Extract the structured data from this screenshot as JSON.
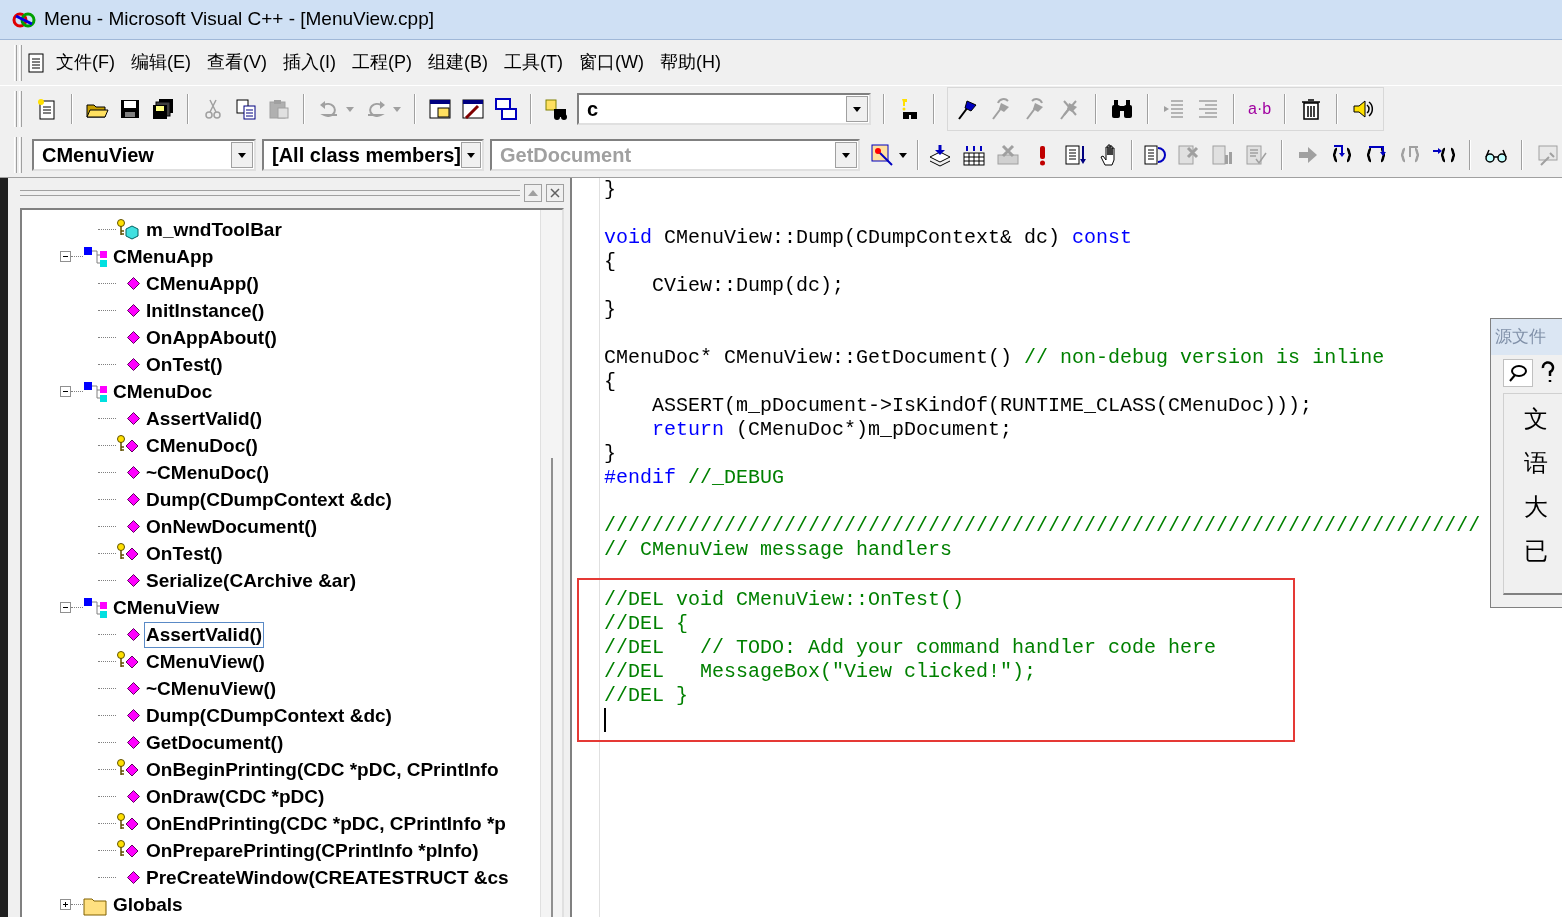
{
  "window": {
    "title": "Menu - Microsoft Visual C++ - [MenuView.cpp]"
  },
  "menu": [
    {
      "label": "文件(F)"
    },
    {
      "label": "编辑(E)"
    },
    {
      "label": "查看(V)"
    },
    {
      "label": "插入(I)"
    },
    {
      "label": "工程(P)"
    },
    {
      "label": "组建(B)"
    },
    {
      "label": "工具(T)"
    },
    {
      "label": "窗口(W)"
    },
    {
      "label": "帮助(H)"
    }
  ],
  "toolbar": {
    "find_combo": {
      "value": "c"
    },
    "format_label": "a·b"
  },
  "wizard_bar": {
    "class_combo": {
      "value": "CMenuView"
    },
    "filter_combo": {
      "value": "[All class members]"
    },
    "member_combo": {
      "value": "GetDocument",
      "disabled": true
    }
  },
  "class_view": {
    "continued_children": [
      {
        "label": "m_wndToolBar",
        "kind": "protected_member",
        "selected": false
      }
    ],
    "items": [
      {
        "label": "CMenuApp",
        "kind": "class",
        "expanded": true,
        "selected": false,
        "children": [
          {
            "label": "CMenuApp()",
            "kind": "method",
            "selected": false
          },
          {
            "label": "InitInstance()",
            "kind": "method",
            "selected": false
          },
          {
            "label": "OnAppAbout()",
            "kind": "method",
            "selected": false
          },
          {
            "label": "OnTest()",
            "kind": "method",
            "selected": false
          }
        ]
      },
      {
        "label": "CMenuDoc",
        "kind": "class",
        "expanded": true,
        "selected": false,
        "children": [
          {
            "label": "AssertValid()",
            "kind": "method",
            "selected": false
          },
          {
            "label": "CMenuDoc()",
            "kind": "protected_method",
            "selected": false
          },
          {
            "label": "~CMenuDoc()",
            "kind": "method",
            "selected": false
          },
          {
            "label": "Dump(CDumpContext &dc)",
            "kind": "method",
            "selected": false
          },
          {
            "label": "OnNewDocument()",
            "kind": "method",
            "selected": false
          },
          {
            "label": "OnTest()",
            "kind": "protected_method",
            "selected": false
          },
          {
            "label": "Serialize(CArchive &ar)",
            "kind": "method",
            "selected": false
          }
        ]
      },
      {
        "label": "CMenuView",
        "kind": "class",
        "expanded": true,
        "selected": false,
        "children": [
          {
            "label": "AssertValid()",
            "kind": "method",
            "selected": true
          },
          {
            "label": "CMenuView()",
            "kind": "protected_method",
            "selected": false
          },
          {
            "label": "~CMenuView()",
            "kind": "method",
            "selected": false
          },
          {
            "label": "Dump(CDumpContext &dc)",
            "kind": "method",
            "selected": false
          },
          {
            "label": "GetDocument()",
            "kind": "method",
            "selected": false
          },
          {
            "label": "OnBeginPrinting(CDC *pDC, CPrintInfo",
            "kind": "protected_method",
            "selected": false
          },
          {
            "label": "OnDraw(CDC *pDC)",
            "kind": "method",
            "selected": false
          },
          {
            "label": "OnEndPrinting(CDC *pDC, CPrintInfo *p",
            "kind": "protected_method",
            "selected": false
          },
          {
            "label": "OnPreparePrinting(CPrintInfo *pInfo)",
            "kind": "protected_method",
            "selected": false
          },
          {
            "label": "PreCreateWindow(CREATESTRUCT &cs",
            "kind": "method",
            "selected": false
          }
        ]
      },
      {
        "label": "Globals",
        "kind": "folder",
        "expanded": false,
        "selected": false
      }
    ]
  },
  "editor": {
    "lines": [
      {
        "kind": "code",
        "segments": [
          {
            "text": "}",
            "kind": "plain"
          }
        ]
      },
      {
        "kind": "blank"
      },
      {
        "kind": "code",
        "segments": [
          {
            "text": "void",
            "kind": "keyword"
          },
          {
            "text": " CMenuView::Dump(CDumpContext& dc) ",
            "kind": "plain"
          },
          {
            "text": "const",
            "kind": "keyword"
          }
        ]
      },
      {
        "kind": "code",
        "segments": [
          {
            "text": "{",
            "kind": "plain"
          }
        ]
      },
      {
        "kind": "code",
        "segments": [
          {
            "text": "    CView::Dump(dc);",
            "kind": "plain"
          }
        ]
      },
      {
        "kind": "code",
        "segments": [
          {
            "text": "}",
            "kind": "plain"
          }
        ]
      },
      {
        "kind": "blank"
      },
      {
        "kind": "code",
        "segments": [
          {
            "text": "CMenuDoc* CMenuView::GetDocument() ",
            "kind": "plain"
          },
          {
            "text": "// non-debug version is inline",
            "kind": "comment"
          }
        ]
      },
      {
        "kind": "code",
        "segments": [
          {
            "text": "{",
            "kind": "plain"
          }
        ]
      },
      {
        "kind": "code",
        "segments": [
          {
            "text": "    ASSERT(m_pDocument->IsKindOf(RUNTIME_CLASS(CMenuDoc)));",
            "kind": "plain"
          }
        ]
      },
      {
        "kind": "code",
        "segments": [
          {
            "text": "    return",
            "kind": "keyword"
          },
          {
            "text": " (CMenuDoc*)m_pDocument;",
            "kind": "plain"
          }
        ]
      },
      {
        "kind": "code",
        "segments": [
          {
            "text": "}",
            "kind": "plain"
          }
        ]
      },
      {
        "kind": "code",
        "segments": [
          {
            "text": "#endif",
            "kind": "keyword"
          },
          {
            "text": " //_DEBUG",
            "kind": "comment"
          }
        ]
      },
      {
        "kind": "blank"
      },
      {
        "kind": "code",
        "segments": [
          {
            "text": "/////////////////////////////////////////////////////////////////////////",
            "kind": "comment"
          }
        ]
      },
      {
        "kind": "code",
        "segments": [
          {
            "text": "// CMenuView message handlers",
            "kind": "comment"
          }
        ]
      },
      {
        "kind": "blank"
      },
      {
        "kind": "code",
        "highlighted": true,
        "segments": [
          {
            "text": "//DEL void CMenuView::OnTest()",
            "kind": "comment"
          }
        ]
      },
      {
        "kind": "code",
        "highlighted": true,
        "segments": [
          {
            "text": "//DEL {",
            "kind": "comment"
          }
        ]
      },
      {
        "kind": "code",
        "highlighted": true,
        "segments": [
          {
            "text": "//DEL   // TODO: Add your command handler code here",
            "kind": "comment"
          }
        ]
      },
      {
        "kind": "code",
        "highlighted": true,
        "segments": [
          {
            "text": "//DEL   MessageBox(\"View clicked!\");",
            "kind": "comment"
          }
        ]
      },
      {
        "kind": "code",
        "highlighted": true,
        "segments": [
          {
            "text": "//DEL }",
            "kind": "comment"
          }
        ]
      },
      {
        "kind": "cursor",
        "highlighted": true
      }
    ]
  },
  "properties_panel": {
    "title": "源文件",
    "rows": [
      "文",
      "语",
      "大",
      "已"
    ]
  }
}
